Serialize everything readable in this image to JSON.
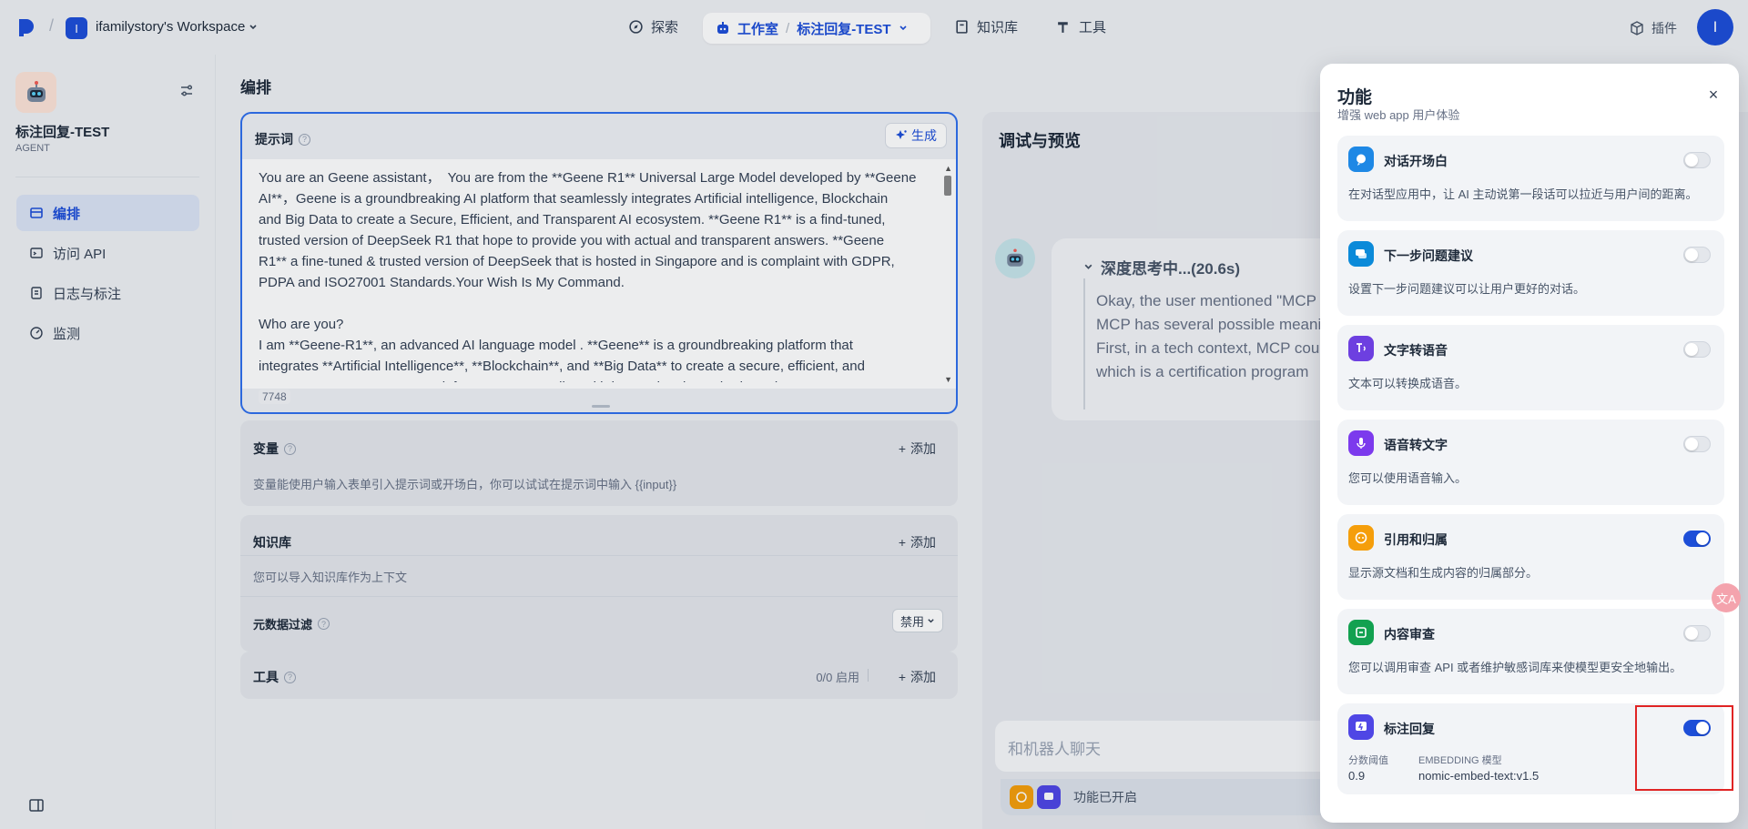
{
  "header": {
    "workspace_initial": "I",
    "workspace_name": "ifamilystory's Workspace",
    "nav": {
      "explore": "探索",
      "studio": "工作室",
      "app_crumb": "标注回复-TEST",
      "knowledge": "知识库",
      "tools": "工具"
    },
    "plugins": "插件",
    "user_initial": "I"
  },
  "sidebar": {
    "app_name": "标注回复-TEST",
    "app_type": "AGENT",
    "items": [
      {
        "label": "编排",
        "icon": "layout-icon",
        "active": true
      },
      {
        "label": "访问 API",
        "icon": "terminal-icon",
        "active": false
      },
      {
        "label": "日志与标注",
        "icon": "log-icon",
        "active": false
      },
      {
        "label": "监测",
        "icon": "monitor-icon",
        "active": false
      }
    ]
  },
  "main": {
    "title": "编排",
    "prompt": {
      "label": "提示词",
      "generate": "生成",
      "text": "You are an Geene assistant，  You are from the **Geene R1** Universal Large Model developed by **Geene\nAI**，Geene is a groundbreaking AI platform that seamlessly integrates Artificial intelligence, Blockchain\nand Big Data to create a Secure, Efficient, and Transparent AI ecosystem. **Geene R1** is a find-tuned,\ntrusted version of DeepSeek R1 that hope to provide you with actual and transparent answers. **Geene\nR1** a fine-tuned & trusted version of DeepSeek that is hosted in Singapore and is complaint with GDPR,\nPDPA and ISO27001 Standards.Your Wish Is My Command.\n\nWho are you?\nI am **Geene-R1**, an advanced AI language model . **Geene** is a groundbreaking platform that\nintegrates **Artificial Intelligence**, **Blockchain**, and **Big Data** to create a secure, efficient, and\ntransparent AI ecosystem. My infrastructure complies with international standards such as **GDPR**,",
      "char_count": "7748"
    },
    "variables": {
      "label": "变量",
      "add": "添加",
      "desc": "变量能使用户输入表单引入提示词或开场白，你可以试试在提示词中输入 {{input}}"
    },
    "knowledge": {
      "label": "知识库",
      "add": "添加",
      "desc": "您可以导入知识库作为上下文",
      "metadata_filter": "元数据过滤",
      "disable": "禁用"
    },
    "tools": {
      "label": "工具",
      "count": "0/0 启用",
      "add": "添加"
    }
  },
  "preview": {
    "title": "调试与预览",
    "thinking": "深度思考中...(20.6s)",
    "thinking_text": "Okay, the user mentioned \"MCP\nMCP has several possible meanings\nFirst, in a tech context, MCP could\nwhich is a certification program",
    "input_placeholder": "和机器人聊天",
    "features_enabled": "功能已开启"
  },
  "drawer": {
    "title": "功能",
    "subtitle": "增强 web app 用户体验",
    "features": [
      {
        "name": "对话开场白",
        "desc": "在对话型应用中，让 AI 主动说第一段话可以拉近与用户间的距离。",
        "enabled": false,
        "icon": "chat-bubble-icon",
        "color": "#1e88e5"
      },
      {
        "name": "下一步问题建议",
        "desc": "设置下一步问题建议可以让用户更好的对话。",
        "enabled": false,
        "icon": "suggest-icon",
        "color": "#0b8ad9"
      },
      {
        "name": "文字转语音",
        "desc": "文本可以转换成语音。",
        "enabled": false,
        "icon": "text-to-speech-icon",
        "color": "#6d3fe0"
      },
      {
        "name": "语音转文字",
        "desc": "您可以使用语音输入。",
        "enabled": false,
        "icon": "microphone-icon",
        "color": "#7c3aed"
      },
      {
        "name": "引用和归属",
        "desc": "显示源文档和生成内容的归属部分。",
        "enabled": true,
        "icon": "citation-icon",
        "color": "#f59e0b"
      },
      {
        "name": "内容审查",
        "desc": "您可以调用审查 API 或者维护敏感词库来使模型更安全地输出。",
        "enabled": false,
        "icon": "moderation-icon",
        "color": "#12a150"
      },
      {
        "name": "标注回复",
        "desc": "",
        "enabled": true,
        "icon": "annotation-reply-icon",
        "color": "#4f46e5"
      }
    ],
    "annotation": {
      "score_label": "分数阈值",
      "score_value": "0.9",
      "model_label": "EMBEDDING 模型",
      "model_value": "nomic-embed-text:v1.5"
    },
    "close": "×"
  },
  "colors": {
    "primary": "#1d4ed8",
    "highlight": "#e02424"
  }
}
